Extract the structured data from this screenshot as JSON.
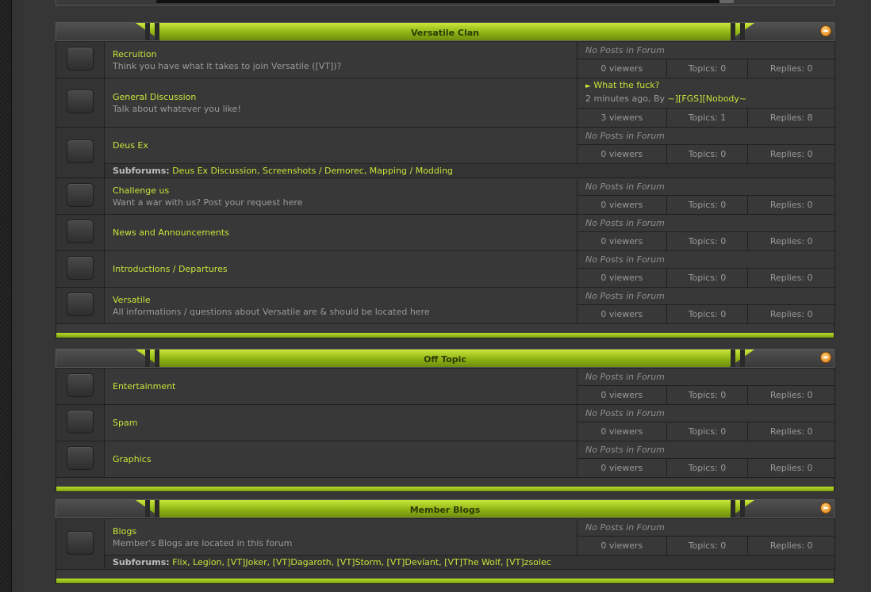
{
  "colors": {
    "accent": "#c6e43a",
    "background": "#363636"
  },
  "categories": [
    {
      "title": "Versatile Clan",
      "forums": [
        {
          "name": "Recruition",
          "desc": "Think you have what it takes to join Versatile ([VT])?",
          "last_post": "No Posts in Forum",
          "viewers": "0 viewers",
          "topics": "Topics: 0",
          "replies": "Replies: 0"
        },
        {
          "name": "General Discussion",
          "desc": "Talk about whatever you like!",
          "last_post_title": "What the fuck?",
          "last_post_meta": "2 minutes ago, By",
          "last_post_user": "~][FGS][Nobody~",
          "viewers": "3 viewers",
          "topics": "Topics: 1",
          "replies": "Replies: 8"
        },
        {
          "name": "Deus Ex",
          "desc": "",
          "last_post": "No Posts in Forum",
          "viewers": "0 viewers",
          "topics": "Topics: 0",
          "replies": "Replies: 0",
          "subforums_label": "Subforums:",
          "subforums": "Deus Ex Discussion, Screenshots / Demorec, Mapping / Modding"
        },
        {
          "name": "Challenge us",
          "desc": "Want a war with us? Post your request here",
          "last_post": "No Posts in Forum",
          "viewers": "0 viewers",
          "topics": "Topics: 0",
          "replies": "Replies: 0"
        },
        {
          "name": "News and Announcements",
          "desc": "",
          "last_post": "No Posts in Forum",
          "viewers": "0 viewers",
          "topics": "Topics: 0",
          "replies": "Replies: 0"
        },
        {
          "name": "Introductions / Departures",
          "desc": "",
          "last_post": "No Posts in Forum",
          "viewers": "0 viewers",
          "topics": "Topics: 0",
          "replies": "Replies: 0"
        },
        {
          "name": "Versatile",
          "desc": "All informations / questions about Versatile are & should be located here",
          "last_post": "No Posts in Forum",
          "viewers": "0 viewers",
          "topics": "Topics: 0",
          "replies": "Replies: 0"
        }
      ]
    },
    {
      "title": "Off Topic",
      "forums": [
        {
          "name": "Entertainment",
          "last_post": "No Posts in Forum",
          "viewers": "0 viewers",
          "topics": "Topics: 0",
          "replies": "Replies: 0"
        },
        {
          "name": "Spam",
          "last_post": "No Posts in Forum",
          "viewers": "0 viewers",
          "topics": "Topics: 0",
          "replies": "Replies: 0"
        },
        {
          "name": "Graphics",
          "last_post": "No Posts in Forum",
          "viewers": "0 viewers",
          "topics": "Topics: 0",
          "replies": "Replies: 0"
        }
      ]
    },
    {
      "title": "Member Blogs",
      "forums": [
        {
          "name": "Blogs",
          "desc": "Member's Blogs are located in this forum",
          "last_post": "No Posts in Forum",
          "viewers": "0 viewers",
          "topics": "Topics: 0",
          "replies": "Replies: 0",
          "subforums_label": "Subforums:",
          "subforums": "Flix, Legion, [VT]Joker, [VT]Dagaroth, [VT]Storm, [VT]Devíant, [VT]The Wolf, [VT]zsolec"
        }
      ]
    }
  ]
}
